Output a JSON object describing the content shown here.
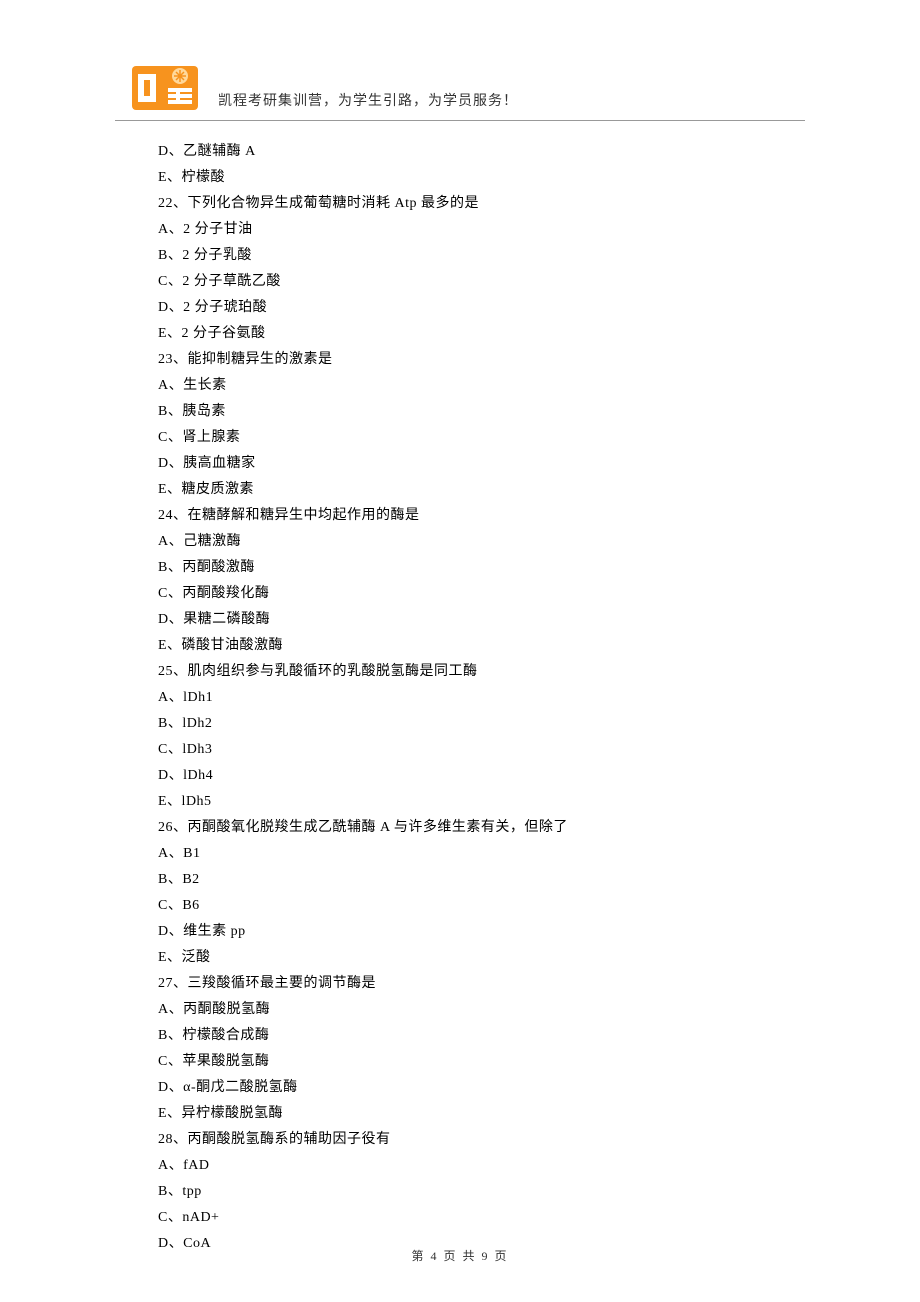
{
  "header": {
    "tagline": "凯程考研集训营，为学生引路，为学员服务！"
  },
  "lines": [
    "D、乙醚辅酶 A",
    "E、柠檬酸",
    "22、下列化合物异生成葡萄糖时消耗 Atp 最多的是",
    "A、2 分子甘油",
    "B、2 分子乳酸",
    "C、2 分子草酰乙酸",
    "D、2 分子琥珀酸",
    "E、2 分子谷氨酸",
    "23、能抑制糖异生的激素是",
    "A、生长素",
    "B、胰岛素",
    "C、肾上腺素",
    "D、胰高血糖家",
    "E、糖皮质激素",
    "24、在糖酵解和糖异生中均起作用的酶是",
    "A、己糖激酶",
    "B、丙酮酸激酶",
    "C、丙酮酸羧化酶",
    "D、果糖二磷酸酶",
    "E、磷酸甘油酸激酶",
    "25、肌肉组织参与乳酸循环的乳酸脱氢酶是同工酶",
    "A、lDh1",
    "B、lDh2",
    "C、lDh3",
    "D、lDh4",
    "E、lDh5",
    "26、丙酮酸氧化脱羧生成乙酰辅酶 A 与许多维生素有关，但除了",
    "A、B1",
    "B、B2",
    "C、B6",
    "D、维生素 pp",
    "E、泛酸",
    "27、三羧酸循环最主要的调节酶是",
    "A、丙酮酸脱氢酶",
    "B、柠檬酸合成酶",
    "C、苹果酸脱氢酶",
    "D、α-酮戊二酸脱氢酶",
    "E、异柠檬酸脱氢酶",
    "28、丙酮酸脱氢酶系的辅助因子役有",
    "A、fAD",
    "B、tpp",
    "C、nAD+",
    "D、CoA"
  ],
  "footer": {
    "text": "第 4 页 共 9 页"
  }
}
